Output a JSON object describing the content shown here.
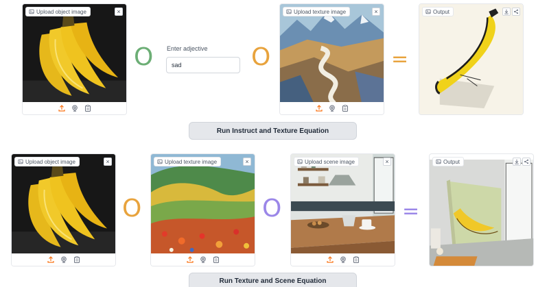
{
  "colors": {
    "green": "#6cae75",
    "orange": "#e8a33d",
    "purple": "#9b87e8",
    "accent_orange": "#f97316"
  },
  "row1": {
    "object_panel": {
      "label": "Upload object image",
      "close": "×"
    },
    "adjective": {
      "label": "Enter adjective",
      "value": "sad"
    },
    "texture_panel": {
      "label": "Upload texture image",
      "close": "×"
    },
    "output_panel": {
      "label": "Output"
    },
    "operators": {
      "op1": "O",
      "op2": "O",
      "equals": "="
    },
    "run_button": "Run Instruct and Texture Equation"
  },
  "row2": {
    "object_panel": {
      "label": "Upload object image",
      "close": "×"
    },
    "texture_panel": {
      "label": "Upload texture image",
      "close": "×"
    },
    "scene_panel": {
      "label": "Upload scene image",
      "close": "×"
    },
    "output_panel": {
      "label": "Output"
    },
    "operators": {
      "op1": "O",
      "op2": "O",
      "equals": "="
    },
    "run_button": "Run Texture and Scene Equation"
  },
  "icons": {
    "upload": "upload-icon",
    "webcam": "webcam-icon",
    "clipboard": "clipboard-icon",
    "image_label": "image-icon",
    "download": "download-icon",
    "share": "share-icon"
  }
}
